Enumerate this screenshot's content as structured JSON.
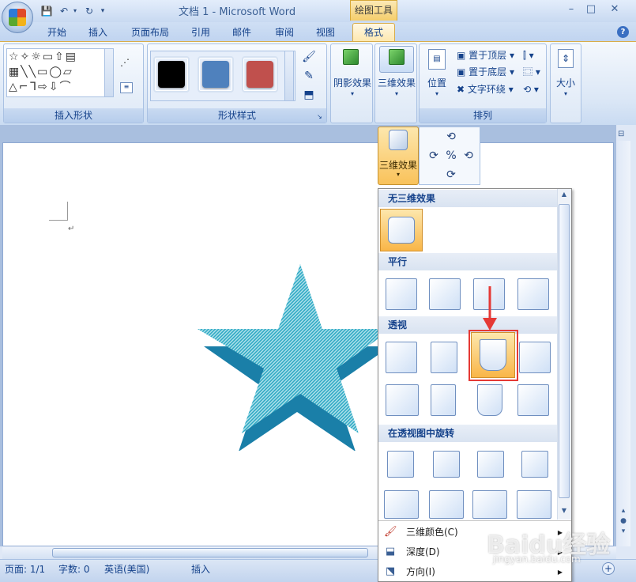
{
  "window": {
    "title": "文档 1 - Microsoft Word",
    "context_tab_group": "绘图工具"
  },
  "quick_access": {
    "save_icon": "save-icon",
    "undo_icon": "undo-icon",
    "redo_icon": "redo-icon"
  },
  "tabs": [
    "开始",
    "插入",
    "页面布局",
    "引用",
    "邮件",
    "审阅",
    "视图",
    "格式"
  ],
  "ribbon": {
    "insert_shapes_label": "插入形状",
    "shape_styles_label": "形状样式",
    "arrange_label": "排列",
    "swatch_colors": [
      "#000000",
      "#4f81bd",
      "#c0504d"
    ],
    "shadow_effects": "阴影效果",
    "threed_effects": "三维效果",
    "position": "位置",
    "bring_to_front": "置于顶层",
    "send_to_back": "置于底层",
    "text_wrap": "文字环绕",
    "size": "大小"
  },
  "dropdown": {
    "button_label": "三维效果",
    "sections": {
      "none": "无三维效果",
      "parallel": "平行",
      "perspective": "透视",
      "perspective_rotation": "在透视图中旋转"
    },
    "menu_items": [
      {
        "label": "三维颜色(C)",
        "icon": "fill-color-icon"
      },
      {
        "label": "深度(D)",
        "icon": "depth-icon"
      },
      {
        "label": "方向(I)",
        "icon": "direction-icon"
      }
    ]
  },
  "document": {
    "paragraph_mark": "↵",
    "star_color": "#2ea9c4",
    "star_shadow_color": "#1a7fa8"
  },
  "status": {
    "page": "页面: 1/1",
    "words": "字数: 0",
    "language": "英语(美国)",
    "mode": "插入"
  },
  "watermark": {
    "text": "Baidu经验",
    "url_text": "jingyan.baidu.com"
  }
}
